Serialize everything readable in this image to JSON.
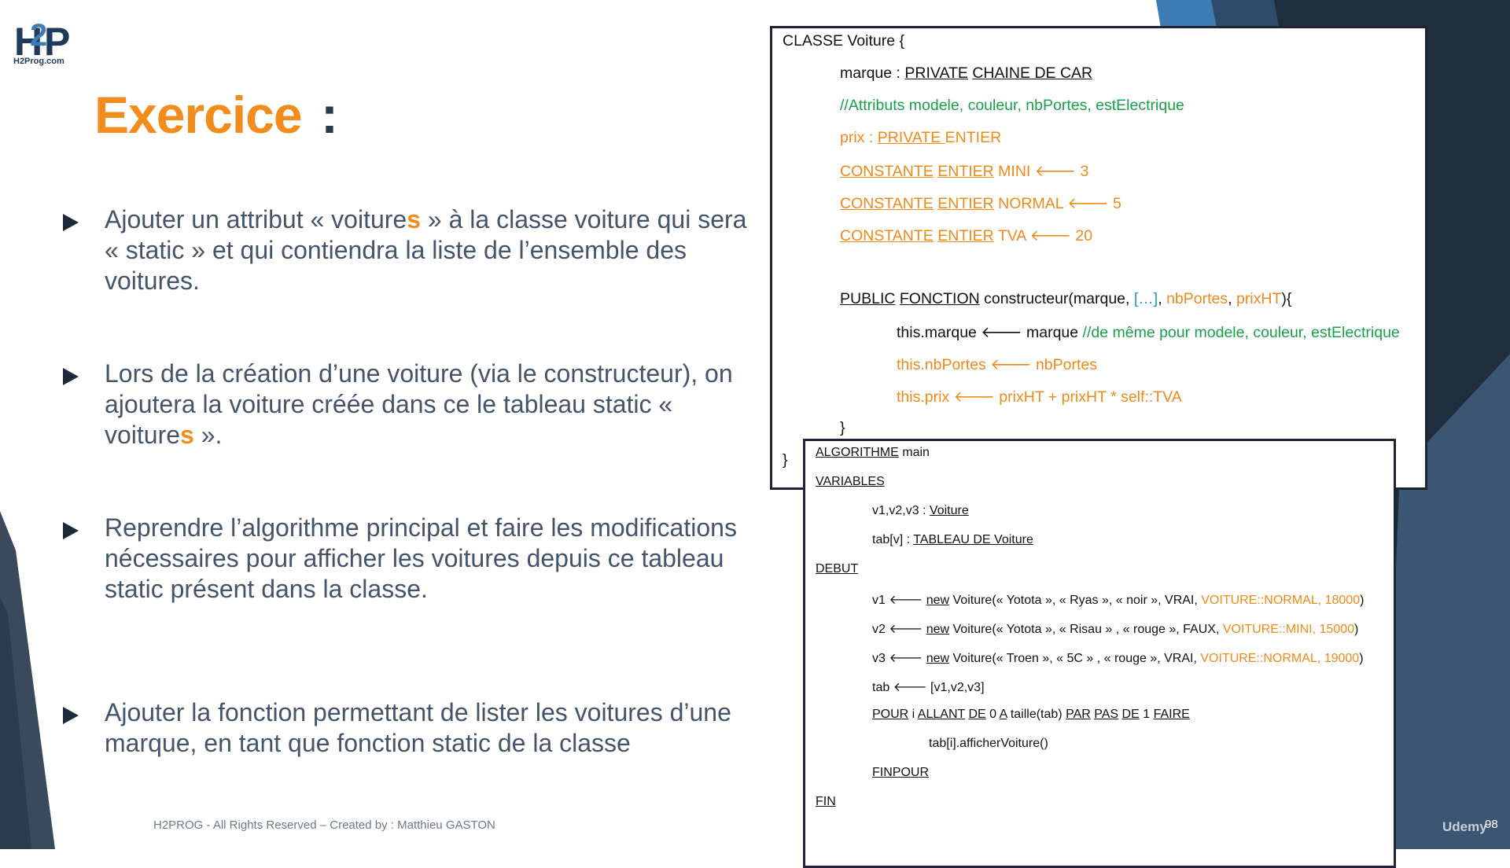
{
  "logo": {
    "text": "H2Prog.com"
  },
  "title": {
    "main": "Exercice",
    "colon": ":"
  },
  "bullets": [
    {
      "pre": "Ajouter un attribut « voiture",
      "hl": "s",
      "post": " » à la classe voiture qui sera « static » et qui contiendra la liste de l’ensemble des voitures."
    },
    {
      "pre": "Lors de la création d’une voiture (via le constructeur), on ajoutera la voiture créée dans ce le tableau static « voiture",
      "hl": "s",
      "post": " »."
    },
    {
      "pre": "Reprendre l’algorithme principal et faire les modifications nécessaires pour afficher les voitures depuis ce tableau static présent dans la classe.",
      "hl": "",
      "post": ""
    },
    {
      "pre": "Ajouter la fonction permettant de lister les voitures d’une marque, en tant que fonction static de la classe",
      "hl": "",
      "post": ""
    }
  ],
  "footer": "H2PROG - All Rights Reserved – Created by : Matthieu GASTON",
  "class_code": {
    "l1": "CLASSE Voiture {",
    "l2a": "marque : ",
    "l2b": "PRIVATE",
    "l2c": " ",
    "l2d": "CHAINE DE CAR",
    "l3": "//Attributs modele, couleur, nbPortes, estElectrique",
    "l4a": "prix : ",
    "l4b": "PRIVATE ",
    "l4c": "ENTIER",
    "l5a": "CONSTANTE",
    "l5b": "ENTIER",
    "l5c": " MINI 🡐 3",
    "l6a": "CONSTANTE",
    "l6b": "ENTIER",
    "l6c": " NORMAL 🡐 5",
    "l7a": "CONSTANTE",
    "l7b": "ENTIER",
    "l7c": " TVA 🡐 20",
    "l8a": "PUBLIC",
    "l8b": "FONCTION",
    "l8c": " constructeur(marque, ",
    "l8d": "[…]",
    "l8e": ", ",
    "l8f": "nbPortes",
    "l8g": ", ",
    "l8h": "prixHT",
    "l8i": "){",
    "l9a": "this.marque 🡐 marque ",
    "l9b": "//de même pour modele, couleur, estElectrique",
    "l10": "this.nbPortes 🡐 nbPortes",
    "l11": "this.prix 🡐 prixHT + prixHT * self::TVA",
    "l12": "}",
    "l13": "}"
  },
  "algo_code": {
    "a1a": "ALGORITHME",
    "a1b": " main",
    "a2": "VARIABLES",
    "a3a": "v1,v2,v3 : ",
    "a3b": "Voiture",
    "a4a": "tab[v] : ",
    "a4b": "TABLEAU DE Voiture",
    "a5": "DEBUT",
    "a6a": "v1 🡐 ",
    "a6b": "new",
    "a6c": " Voiture(« Yotota », « Ryas », « noir », VRAI, ",
    "a6d": "VOITURE::NORMAL, 18000",
    "a6e": ")",
    "a7a": "v2 🡐 ",
    "a7b": "new",
    "a7c": " Voiture(« Yotota », « Risau » , « rouge », FAUX, ",
    "a7d": "VOITURE::MINI, 15000",
    "a7e": ")",
    "a8a": "v3 🡐 ",
    "a8b": "new",
    "a8c": " Voiture(« Troen », « 5C » , « rouge », VRAI, ",
    "a8d": "VOITURE::NORMAL, 19000",
    "a8e": ")",
    "a9": "tab 🡐 [v1,v2,v3]",
    "a10a": "POUR",
    "a10b": " i ",
    "a10c": "ALLANT",
    "a10d": " ",
    "a10e": "DE",
    "a10f": " 0 ",
    "a10g": "A",
    "a10h": " taille(tab) ",
    "a10i": "PAR",
    "a10j": " ",
    "a10k": "PAS",
    "a10l": " ",
    "a10m": "DE",
    "a10n": " 1 ",
    "a10o": "FAIRE",
    "a11": "tab[i].afficherVoiture()",
    "a12": "FINPOUR",
    "a13": "FIN"
  },
  "udemy": "Udemy",
  "page_number": "98",
  "colors": {
    "accent": "#f28c1c",
    "dark": "#1e2a3a",
    "text": "#44546a",
    "green": "#18a04a"
  }
}
